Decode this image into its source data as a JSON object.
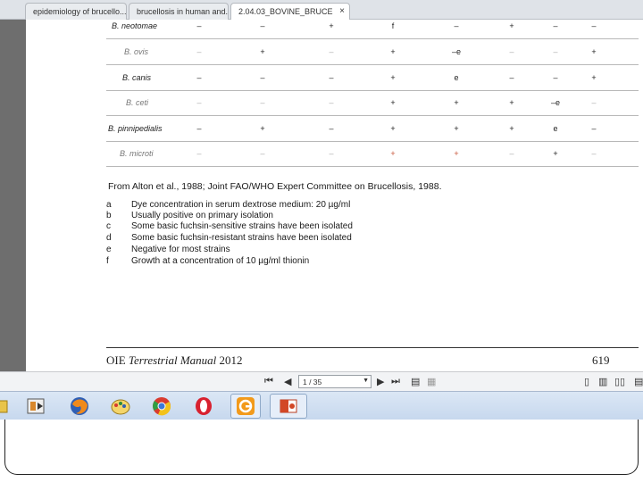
{
  "tabs": [
    {
      "label": "epidemiology of brucello..."
    },
    {
      "label": "brucellosis in human and..."
    },
    {
      "label": "2.04.03_BOVINE_BRUCE",
      "close": "×"
    }
  ],
  "table": {
    "rows": [
      {
        "name": "B. neotomae",
        "faded": false,
        "values": [
          "–",
          "–",
          "+",
          "f",
          "–",
          "+",
          "–",
          "–"
        ]
      },
      {
        "name": "B. ovis",
        "faded": true,
        "values": [
          "–",
          "+",
          "–",
          "+",
          "–e",
          "–",
          "–",
          "+"
        ]
      },
      {
        "name": "B. canis",
        "faded": false,
        "values": [
          "–",
          "–",
          "–",
          "+",
          "e",
          "–",
          "–",
          "+"
        ]
      },
      {
        "name": "B. ceti",
        "faded": true,
        "values": [
          "–",
          "–",
          "–",
          "+",
          "+",
          "+",
          "–e",
          "–"
        ]
      },
      {
        "name": "B. pinnipedialis",
        "faded": false,
        "values": [
          "–",
          "+",
          "–",
          "+",
          "+",
          "+",
          "e",
          "–"
        ]
      },
      {
        "name": "B. microti",
        "faded": true,
        "values": [
          "–",
          "–",
          "–",
          "+",
          "+",
          "–",
          "+",
          "–"
        ]
      }
    ]
  },
  "source_line": "From Alton et al., 1988; Joint FAO/WHO Expert Committee on Brucellosis, 1988.",
  "footnotes": [
    {
      "key": "a",
      "text": "Dye concentration in serum dextrose medium: 20 µg/ml"
    },
    {
      "key": "b",
      "text": "Usually positive on primary isolation"
    },
    {
      "key": "c",
      "text": "Some basic fuchsin-sensitive strains have been isolated"
    },
    {
      "key": "d",
      "text": "Some basic fuchsin-resistant strains have been isolated"
    },
    {
      "key": "e",
      "text": "Negative for most strains"
    },
    {
      "key": "f",
      "text": "Growth at a concentration of 10 µg/ml thionin"
    }
  ],
  "footer": {
    "manual_prefix": "OIE",
    "manual_italic": "Terrestrial Manual",
    "year": "2012",
    "page_number": "619"
  },
  "pdf_toolbar": {
    "page_indicator": "1 / 35"
  },
  "taskbar": {
    "apps": [
      "file-explorer-icon",
      "media-player-icon",
      "firefox-icon",
      "paint-icon",
      "chrome-icon",
      "opera-icon",
      "presenter-icon",
      "powerpoint-icon"
    ]
  }
}
